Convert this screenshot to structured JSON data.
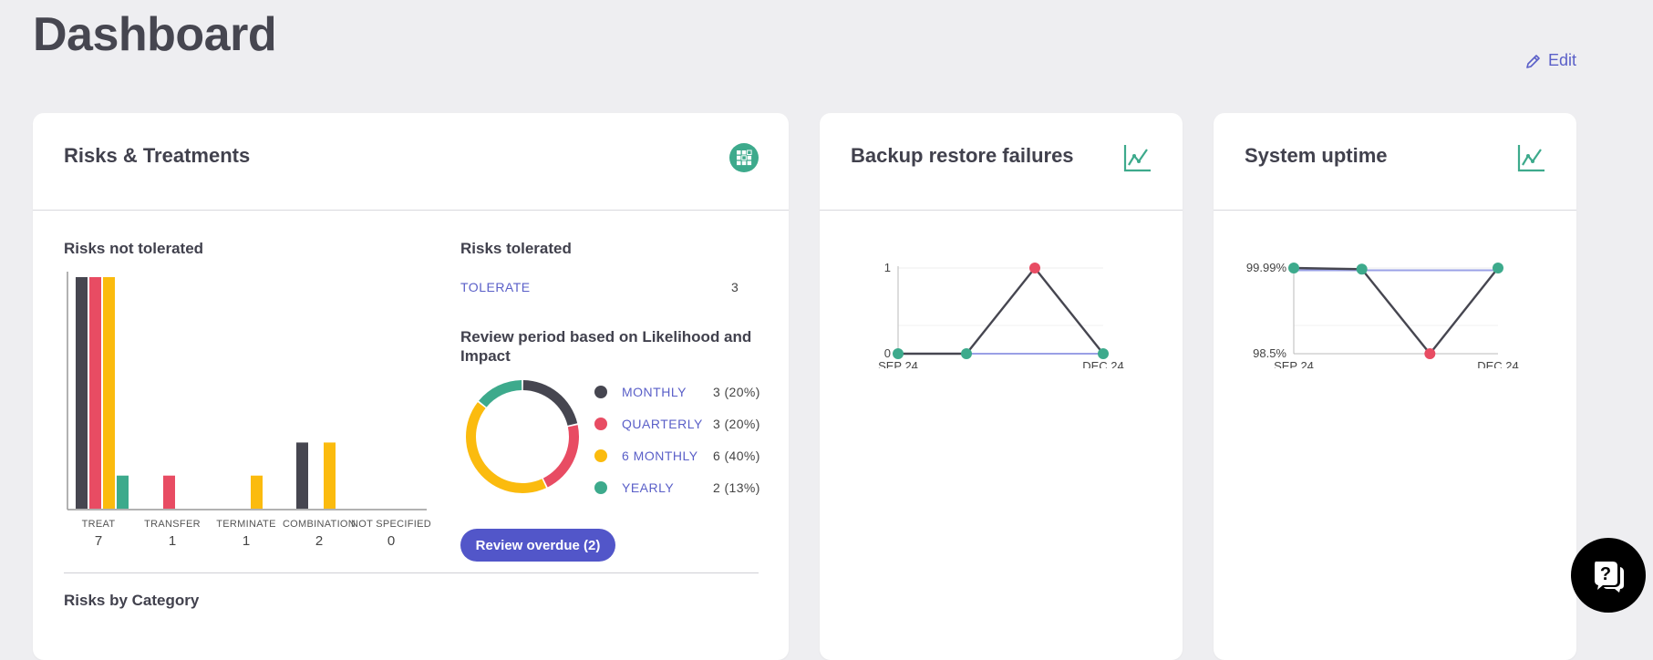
{
  "page": {
    "title": "Dashboard",
    "edit_label": "Edit"
  },
  "colors": {
    "dark": "#464650",
    "red": "#e84c63",
    "yellow": "#fbbb0e",
    "green": "#3daa8c",
    "accent": "#5a5fc8",
    "button": "#5256c9"
  },
  "risks_card": {
    "title": "Risks & Treatments",
    "action_icon": "table-icon",
    "not_tolerated": {
      "title": "Risks not tolerated",
      "categories": [
        {
          "label": "TREAT",
          "value": "7"
        },
        {
          "label": "TRANSFER",
          "value": "1"
        },
        {
          "label": "TERMINATE",
          "value": "1"
        },
        {
          "label": "COMBINATION",
          "value": "2"
        },
        {
          "label": "NOT SPECIFIED",
          "value": "0"
        }
      ]
    },
    "tolerated": {
      "title": "Risks tolerated",
      "rows": [
        {
          "label": "TOLERATE",
          "value": "3"
        }
      ]
    },
    "review": {
      "title": "Review period based on Likelihood and Impact",
      "legend": [
        {
          "label": "MONTHLY",
          "count": "3 (20%)",
          "color": "#464650"
        },
        {
          "label": "QUARTERLY",
          "count": "3 (20%)",
          "color": "#e84c63"
        },
        {
          "label": "6 MONTHLY",
          "count": "6 (40%)",
          "color": "#fbbb0e"
        },
        {
          "label": "YEARLY",
          "count": "2 (13%)",
          "color": "#3daa8c"
        }
      ],
      "button_label": "Review overdue (2)"
    },
    "by_category_title": "Risks by Category"
  },
  "backup_card": {
    "title": "Backup restore failures",
    "action_icon": "line-chart-icon"
  },
  "uptime_card": {
    "title": "System uptime",
    "action_icon": "line-chart-icon"
  },
  "chart_data": [
    {
      "type": "bar",
      "categories": [
        "TREAT",
        "TRANSFER",
        "TERMINATE",
        "COMBINATION",
        "NOT SPECIFIED"
      ],
      "series": [
        {
          "color": "#464650",
          "values": [
            7,
            0,
            0,
            2,
            0
          ]
        },
        {
          "color": "#e84c63",
          "values": [
            7,
            1,
            0,
            0,
            0
          ]
        },
        {
          "color": "#fbbb0e",
          "values": [
            7,
            0,
            1,
            2,
            0
          ]
        },
        {
          "color": "#3daa8c",
          "values": [
            1,
            0,
            0,
            0,
            0
          ]
        }
      ],
      "ylim": [
        0,
        7
      ]
    },
    {
      "type": "pie",
      "labels": [
        "MONTHLY",
        "QUARTERLY",
        "6 MONTHLY",
        "YEARLY"
      ],
      "values": [
        3,
        3,
        6,
        2
      ],
      "colors": [
        "#464650",
        "#e84c63",
        "#fbbb0e",
        "#3daa8c"
      ]
    },
    {
      "type": "line",
      "x_labels": [
        "SEP 24",
        "DEC 24"
      ],
      "points": [
        0,
        0,
        1,
        0
      ],
      "point_colors": [
        "#3daa8c",
        "#3daa8c",
        "#e84c63",
        "#3daa8c"
      ],
      "target": [
        0,
        0
      ],
      "ylim": [
        0,
        1
      ],
      "y_labels": [
        "1",
        "0"
      ]
    },
    {
      "type": "line",
      "x_labels": [
        "SEP 24",
        "DEC 24"
      ],
      "points": [
        99.99,
        99.97,
        98.5,
        99.99
      ],
      "point_colors": [
        "#3daa8c",
        "#3daa8c",
        "#e84c63",
        "#3daa8c"
      ],
      "target": [
        99.95,
        99.95
      ],
      "ylim": [
        98.5,
        99.99
      ],
      "y_labels": [
        "99.99%",
        "98.5%"
      ]
    }
  ]
}
